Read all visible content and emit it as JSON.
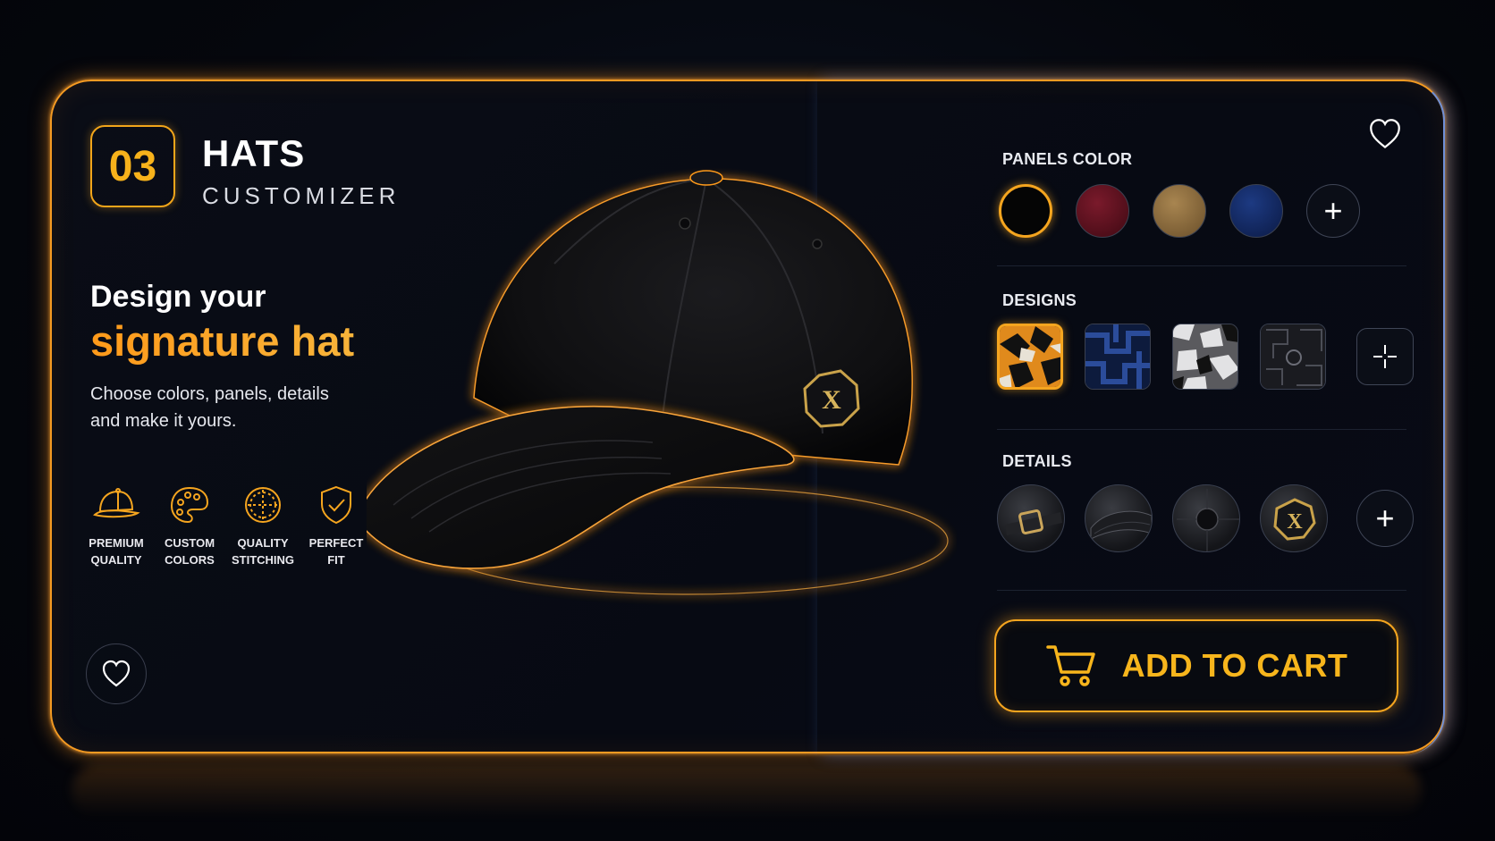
{
  "header": {
    "number": "03",
    "title": "HATS",
    "subtitle": "CUSTOMIZER"
  },
  "hero": {
    "line1": "Design your",
    "line2": "signature hat",
    "description": "Choose colors, panels, details and make it yours."
  },
  "features": [
    {
      "icon": "cap-icon",
      "label": "PREMIUM\nQUALITY"
    },
    {
      "icon": "palette-icon",
      "label": "CUSTOM\nCOLORS"
    },
    {
      "icon": "stitching-icon",
      "label": "QUALITY\nSTITCHING"
    },
    {
      "icon": "shield-check-icon",
      "label": "PERFECT\nFIT"
    }
  ],
  "panels_color": {
    "label": "PANELS COLOR",
    "swatches": [
      {
        "color": "#050505",
        "selected": true
      },
      {
        "color": "#5a0f1c",
        "selected": false
      },
      {
        "color": "#8e6e3f",
        "selected": false
      },
      {
        "color": "#132a66",
        "selected": false
      }
    ],
    "add_icon": "plus-icon"
  },
  "designs": {
    "label": "DESIGNS",
    "items": [
      {
        "name": "orange-camo",
        "selected": true
      },
      {
        "name": "blue-geometric",
        "selected": false
      },
      {
        "name": "grey-camo",
        "selected": false
      },
      {
        "name": "dark-pattern",
        "selected": false
      }
    ],
    "add_icon": "crosshair-plus-icon"
  },
  "details": {
    "label": "DETAILS",
    "items": [
      "buckle",
      "visor",
      "top-button",
      "x-emblem"
    ],
    "add_icon": "plus-icon"
  },
  "cta": {
    "label": "ADD TO CART",
    "icon": "cart-icon"
  },
  "emblem_letter": "X",
  "colors": {
    "accent": "#f5a51f",
    "accent_orange": "#ff9a1a",
    "edge_blue": "#6f8fd6"
  }
}
